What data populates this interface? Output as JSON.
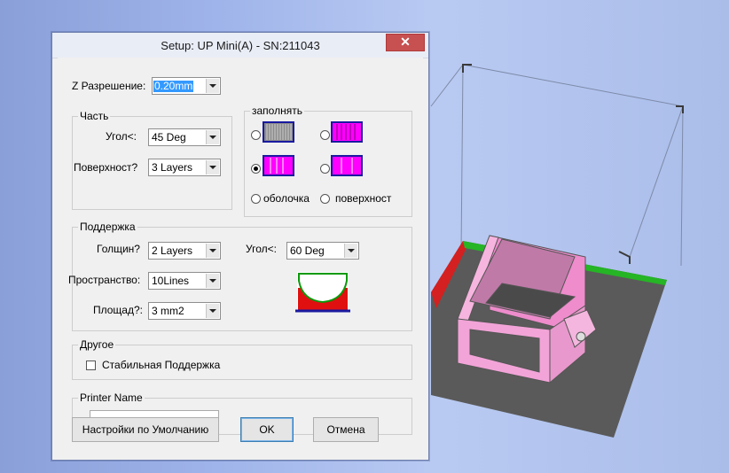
{
  "window": {
    "title": "Setup: UP Mini(A) - SN:211043",
    "close_glyph": "✕"
  },
  "z_resolution": {
    "label": "Z Разрешение:",
    "value": "0.20mm"
  },
  "part": {
    "legend": "Часть",
    "angle_label": "Угол<:",
    "angle_value": "45 Deg",
    "surface_label": "Поверхност?",
    "surface_value": "3 Layers"
  },
  "fill": {
    "legend": "заполнять",
    "selected_option": 3,
    "shell_label": "оболочка",
    "surface_label": "поверхност"
  },
  "support": {
    "legend": "Поддержка",
    "thickness_label": "Голщин?",
    "thickness_value": "2 Layers",
    "angle_label": "Угол<:",
    "angle_value": "60 Deg",
    "space_label": "Пространство:",
    "space_value": "10Lines",
    "area_label": "Площад?:",
    "area_value": "3 mm2"
  },
  "other": {
    "legend": "Другое",
    "stable_support_label": "Стабильная Поддержка",
    "stable_support_checked": false
  },
  "printer": {
    "legend": "Printer Name",
    "value": ""
  },
  "buttons": {
    "defaults": "Настройки по Умолчанию",
    "ok": "OK",
    "cancel": "Отмена"
  },
  "colors": {
    "magenta": "#ff00ff",
    "icon_border": "#1a1aa0",
    "model_pink": "#ee8ccc",
    "bed": "#5a5a5a",
    "close_red": "#c75050"
  }
}
